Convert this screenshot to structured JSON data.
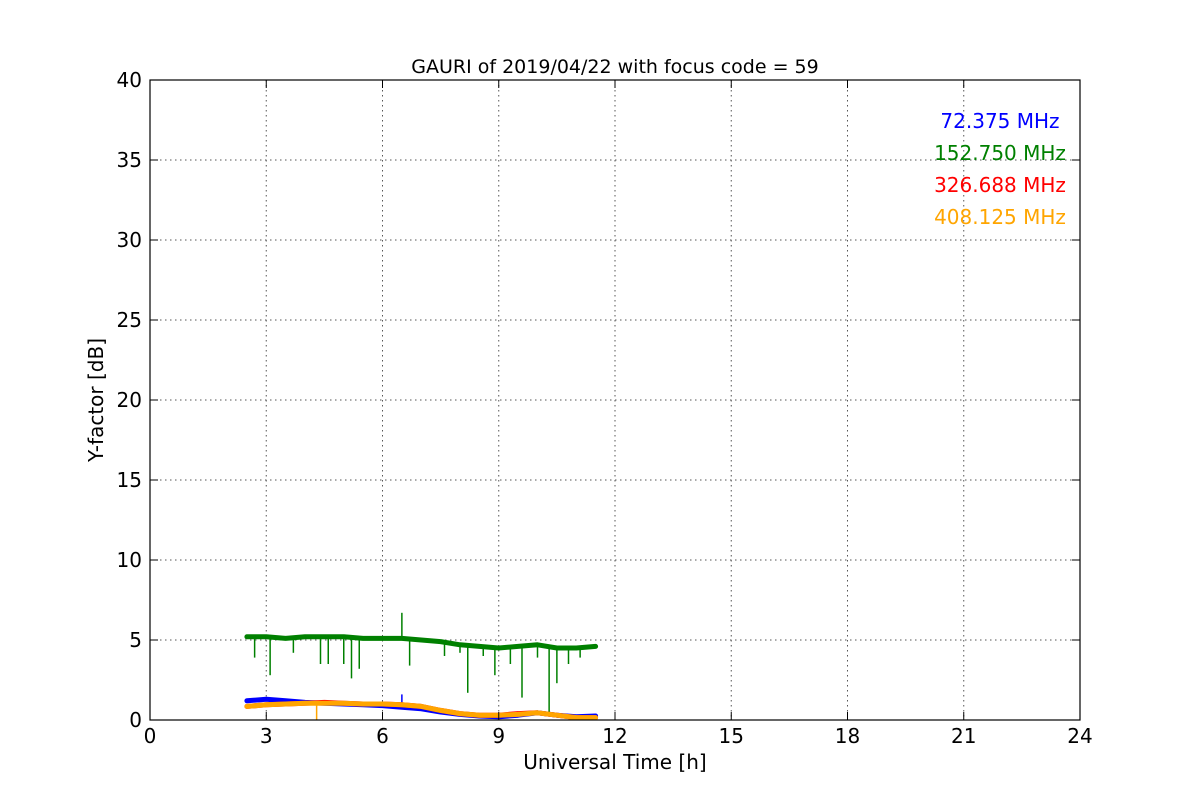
{
  "chart_data": {
    "type": "line",
    "title": "GAURI of 2019/04/22 with focus code = 59",
    "xlabel": "Universal Time [h]",
    "ylabel": "Y-factor [dB]",
    "xlim": [
      0,
      24
    ],
    "ylim": [
      0,
      40
    ],
    "xticks": [
      "0",
      "3",
      "6",
      "9",
      "12",
      "15",
      "18",
      "21",
      "24"
    ],
    "yticks": [
      "0",
      "5",
      "10",
      "15",
      "20",
      "25",
      "30",
      "35",
      "40"
    ],
    "grid": true,
    "legend_placement": "top-right",
    "series": [
      {
        "name": "72.375 MHz",
        "color": "#0000ff",
        "x": [
          2.5,
          3.0,
          3.5,
          4.0,
          4.5,
          5.0,
          5.5,
          6.0,
          6.5,
          7.0,
          7.5,
          8.0,
          8.5,
          9.0,
          9.5,
          10.0,
          10.5,
          11.0,
          11.5
        ],
        "y": [
          1.2,
          1.3,
          1.2,
          1.1,
          1.05,
          1.0,
          0.95,
          0.9,
          0.8,
          0.7,
          0.5,
          0.35,
          0.25,
          0.2,
          0.3,
          0.45,
          0.3,
          0.2,
          0.25
        ],
        "spikes": [
          [
            6.5,
            1.6
          ]
        ]
      },
      {
        "name": "152.750 MHz",
        "color": "#008000",
        "x": [
          2.5,
          3.0,
          3.5,
          4.0,
          4.5,
          5.0,
          5.5,
          6.0,
          6.5,
          7.0,
          7.5,
          8.0,
          8.5,
          9.0,
          9.5,
          10.0,
          10.5,
          11.0,
          11.5
        ],
        "y": [
          5.2,
          5.2,
          5.1,
          5.2,
          5.2,
          5.2,
          5.1,
          5.1,
          5.1,
          5.0,
          4.9,
          4.7,
          4.6,
          4.5,
          4.6,
          4.7,
          4.5,
          4.5,
          4.6
        ],
        "spikes": [
          [
            2.7,
            3.9
          ],
          [
            3.1,
            2.8
          ],
          [
            3.7,
            4.2
          ],
          [
            4.4,
            3.5
          ],
          [
            4.6,
            3.5
          ],
          [
            5.0,
            3.5
          ],
          [
            5.2,
            2.6
          ],
          [
            5.4,
            3.2
          ],
          [
            6.5,
            6.7
          ],
          [
            6.7,
            3.4
          ],
          [
            7.6,
            4.0
          ],
          [
            8.0,
            4.2
          ],
          [
            8.2,
            1.7
          ],
          [
            8.6,
            4.0
          ],
          [
            8.9,
            2.8
          ],
          [
            9.3,
            3.5
          ],
          [
            9.6,
            1.4
          ],
          [
            10.0,
            3.9
          ],
          [
            10.3,
            0.4
          ],
          [
            10.5,
            2.3
          ],
          [
            10.8,
            3.5
          ],
          [
            11.1,
            3.9
          ]
        ]
      },
      {
        "name": "326.688 MHz",
        "color": "#ff0000",
        "x": [
          2.5,
          3.0,
          3.5,
          4.0,
          4.5,
          5.0,
          5.5,
          6.0,
          6.5,
          7.0,
          7.5,
          8.0,
          8.5,
          9.0,
          9.5,
          10.0,
          10.5,
          11.0,
          11.5
        ],
        "y": [
          0.85,
          0.95,
          1.0,
          1.05,
          1.1,
          1.05,
          1.0,
          1.0,
          0.95,
          0.85,
          0.6,
          0.4,
          0.3,
          0.3,
          0.4,
          0.45,
          0.3,
          0.15,
          0.15
        ],
        "spikes": []
      },
      {
        "name": "408.125 MHz",
        "color": "#ffa500",
        "x": [
          2.5,
          3.0,
          3.5,
          4.0,
          4.5,
          5.0,
          5.5,
          6.0,
          6.5,
          7.0,
          7.5,
          8.0,
          8.5,
          9.0,
          9.5,
          10.0,
          10.5,
          11.0,
          11.5
        ],
        "y": [
          0.85,
          0.95,
          1.0,
          1.05,
          1.05,
          1.05,
          1.0,
          1.0,
          0.95,
          0.85,
          0.6,
          0.4,
          0.3,
          0.3,
          0.35,
          0.45,
          0.3,
          0.15,
          0.15
        ],
        "spikes": [
          [
            4.3,
            0.0
          ]
        ]
      }
    ]
  }
}
